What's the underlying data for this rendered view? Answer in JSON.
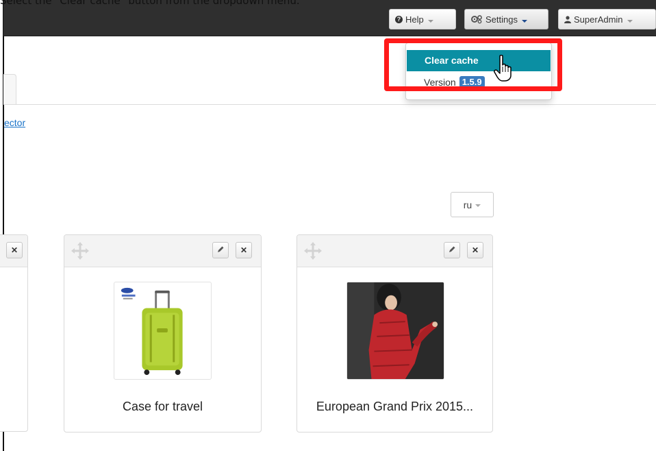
{
  "instruction": "Select the \"Clear cache\" button from the dropdown menu.",
  "header": {
    "help_label": "Help",
    "settings_label": "Settings",
    "user_label": "SuperAdmin"
  },
  "settings_menu": {
    "clear_cache_label": "Clear cache",
    "version_label": "Version",
    "version_value": "1.5.9"
  },
  "main": {
    "partial_link": "ector",
    "language": "ru"
  },
  "products": [
    {
      "title": "Case for travel"
    },
    {
      "title": "European Grand Prix 2015..."
    }
  ],
  "colors": {
    "topbar": "#2f2f2f",
    "menu_active": "#0b8fa3",
    "highlight": "#ff1a1a",
    "link": "#1a73c8"
  }
}
